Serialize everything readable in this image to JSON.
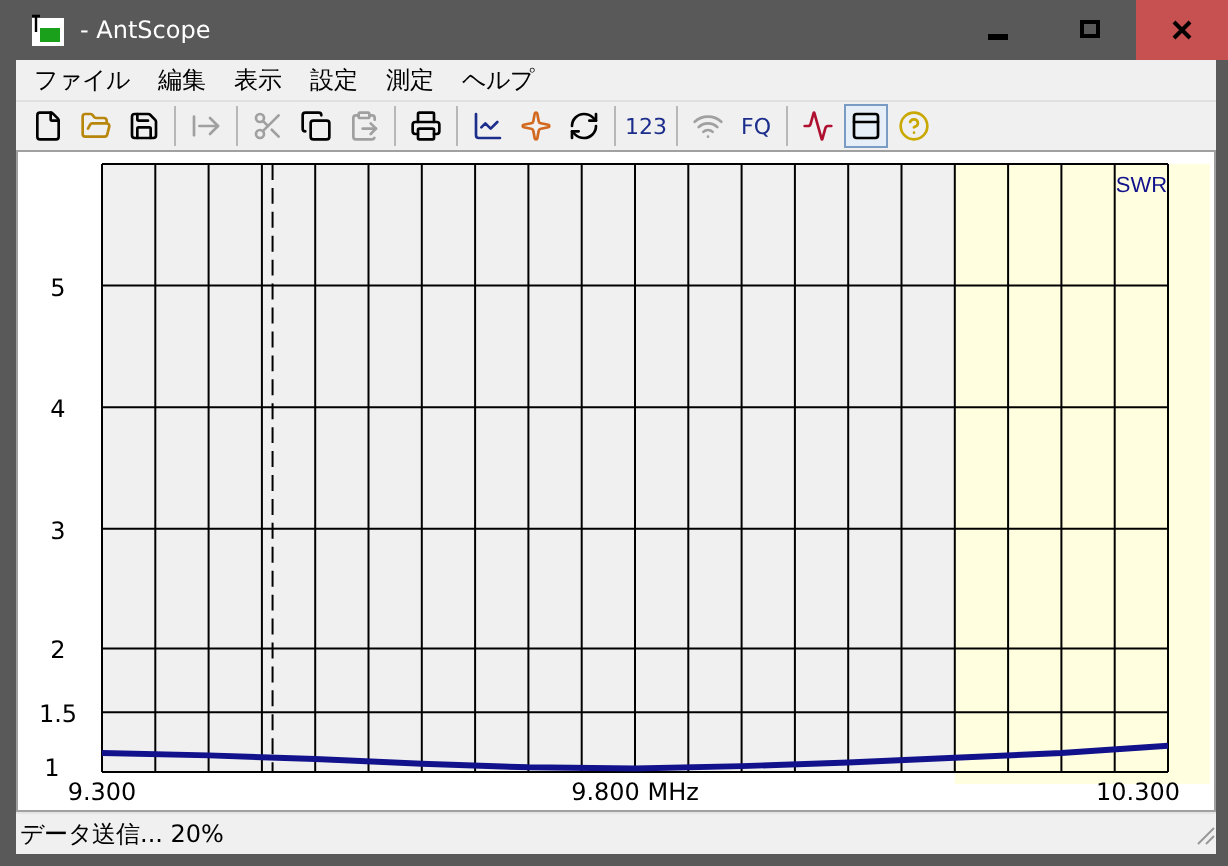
{
  "window": {
    "title": "- AntScope"
  },
  "menu": [
    "ファイル",
    "編集",
    "表示",
    "設定",
    "測定",
    "ヘルプ"
  ],
  "toolbar": [
    {
      "kind": "icon",
      "disabled": false,
      "pressed": false
    },
    {
      "kind": "icon",
      "disabled": false,
      "pressed": false
    },
    {
      "kind": "icon",
      "disabled": false,
      "pressed": false
    },
    {
      "kind": "separator"
    },
    {
      "kind": "icon",
      "disabled": true,
      "pressed": false
    },
    {
      "kind": "separator"
    },
    {
      "kind": "icon",
      "disabled": true,
      "pressed": false
    },
    {
      "kind": "icon",
      "disabled": false,
      "pressed": false
    },
    {
      "kind": "icon",
      "disabled": true,
      "pressed": false
    },
    {
      "kind": "separator"
    },
    {
      "kind": "icon",
      "disabled": false,
      "pressed": false
    },
    {
      "kind": "separator"
    },
    {
      "kind": "icon",
      "disabled": false,
      "pressed": false
    },
    {
      "kind": "icon",
      "disabled": false,
      "pressed": false
    },
    {
      "kind": "icon",
      "disabled": false,
      "pressed": false
    },
    {
      "kind": "separator"
    },
    {
      "kind": "text",
      "label": "123",
      "disabled": false,
      "pressed": false
    },
    {
      "kind": "separator"
    },
    {
      "kind": "icon",
      "disabled": true,
      "pressed": false
    },
    {
      "kind": "text",
      "label": "FQ",
      "disabled": false,
      "pressed": false
    },
    {
      "kind": "separator"
    },
    {
      "kind": "icon",
      "disabled": false,
      "pressed": false
    },
    {
      "kind": "icon",
      "disabled": false,
      "pressed": true
    },
    {
      "kind": "icon",
      "disabled": false,
      "pressed": false
    }
  ],
  "chart_data": {
    "type": "line",
    "x": [
      9.3,
      9.4,
      9.5,
      9.6,
      9.7,
      9.8,
      9.9,
      10.0,
      10.1,
      10.2,
      10.3
    ],
    "series": [
      {
        "name": "SWR",
        "color": "#12128c",
        "values": [
          1.16,
          1.14,
          1.11,
          1.07,
          1.04,
          1.03,
          1.05,
          1.08,
          1.12,
          1.16,
          1.22
        ]
      }
    ],
    "xlim": [
      9.3,
      10.3
    ],
    "ylim": [
      1,
      6
    ],
    "xticks": [
      {
        "value": 9.3,
        "label": "9.300"
      },
      {
        "value": 9.8,
        "label": "9.800 MHz"
      },
      {
        "value": 10.3,
        "label": "10.300"
      }
    ],
    "yticks": [
      {
        "value": 1,
        "label": "1"
      },
      {
        "value": 1.5,
        "label": "1.5"
      },
      {
        "value": 2,
        "label": "2"
      },
      {
        "value": 3,
        "label": "3"
      },
      {
        "value": 4,
        "label": "4"
      },
      {
        "value": 5,
        "label": "5"
      }
    ],
    "grid": true
  },
  "status_bar": "データ送信... 20%"
}
